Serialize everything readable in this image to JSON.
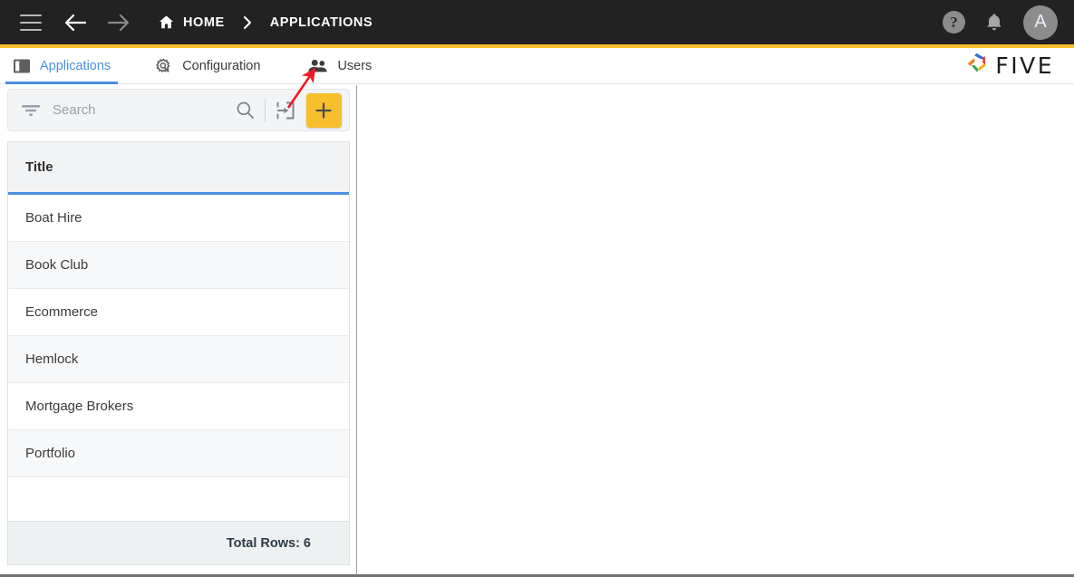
{
  "topbar": {
    "menu_icon": "hamburger-icon",
    "back_icon": "arrow-left-icon",
    "forward_icon": "arrow-right-icon",
    "home_icon": "home-icon",
    "home_label": "HOME",
    "separator": "›",
    "current_label": "APPLICATIONS",
    "help_label": "?",
    "bell_icon": "bell-icon",
    "avatar_initial": "A",
    "background_color": "#222222",
    "accent_color": "#f6bf2b"
  },
  "tabs": [
    {
      "label": "Applications",
      "icon": "split-panel-icon",
      "active": true
    },
    {
      "label": "Configuration",
      "icon": "gear-wrench-icon",
      "active": false
    },
    {
      "label": "Users",
      "icon": "people-icon",
      "active": false
    }
  ],
  "brand": {
    "logo_icon": "five-pinwheel-logo",
    "name": "FIVE",
    "colors": [
      "#2f6fd0",
      "#e03c31",
      "#f4b400",
      "#34a853",
      "#f58220"
    ]
  },
  "toolbar": {
    "filter_icon": "filter-icon",
    "search_placeholder": "Search",
    "search_value": "",
    "search_icon": "search-icon",
    "import_icon": "import-icon",
    "add_icon": "plus-icon",
    "add_button_color": "#f6bf2b"
  },
  "grid": {
    "columns": [
      "Title"
    ],
    "rows": [
      {
        "title": "Boat Hire"
      },
      {
        "title": "Book Club"
      },
      {
        "title": "Ecommerce"
      },
      {
        "title": "Hemlock"
      },
      {
        "title": "Mortgage Brokers"
      },
      {
        "title": "Portfolio"
      }
    ],
    "footer_text": "Total Rows: 6",
    "header_underline_color": "#4a8fe0"
  },
  "annotation": {
    "type": "arrow",
    "color": "#ee1b24",
    "points_to": "Users tab"
  }
}
